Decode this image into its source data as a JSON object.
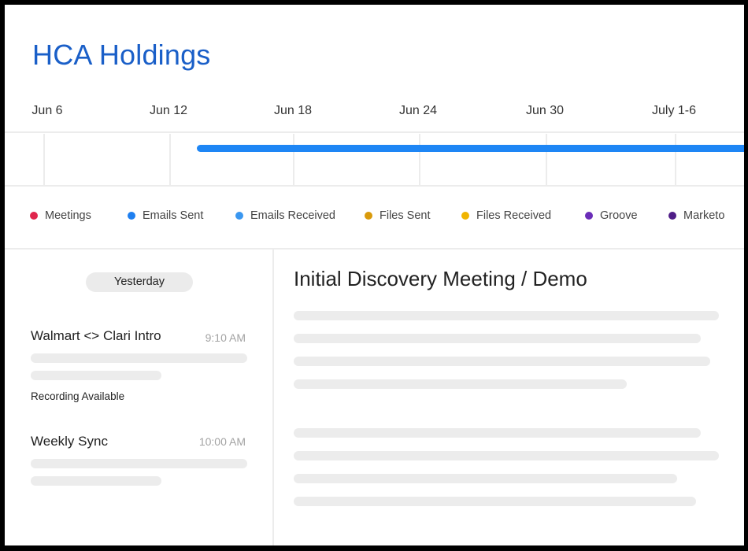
{
  "company": {
    "name": "HCA Holdings"
  },
  "timeline": {
    "dates": [
      "Jun 6",
      "Jun 12",
      "Jun 18",
      "Jun 24",
      "Jun 30",
      "July 1-6"
    ]
  },
  "legend": [
    {
      "label": "Meetings",
      "color": "#e0264d"
    },
    {
      "label": "Emails Sent",
      "color": "#1e7ff0"
    },
    {
      "label": "Emails Received",
      "color": "#3a97f0"
    },
    {
      "label": "Files Sent",
      "color": "#d99a0b"
    },
    {
      "label": "Files Received",
      "color": "#f0b400"
    },
    {
      "label": "Groove",
      "color": "#6a2db8"
    },
    {
      "label": "Marketo",
      "color": "#4f1d87"
    }
  ],
  "activity": {
    "day_label": "Yesterday",
    "events": [
      {
        "title": "Walmart <> Clari Intro",
        "time": "9:10 AM",
        "note": "Recording Available"
      },
      {
        "title": "Weekly Sync",
        "time": "10:00 AM"
      }
    ]
  },
  "detail": {
    "title": "Initial Discovery Meeting / Demo"
  }
}
